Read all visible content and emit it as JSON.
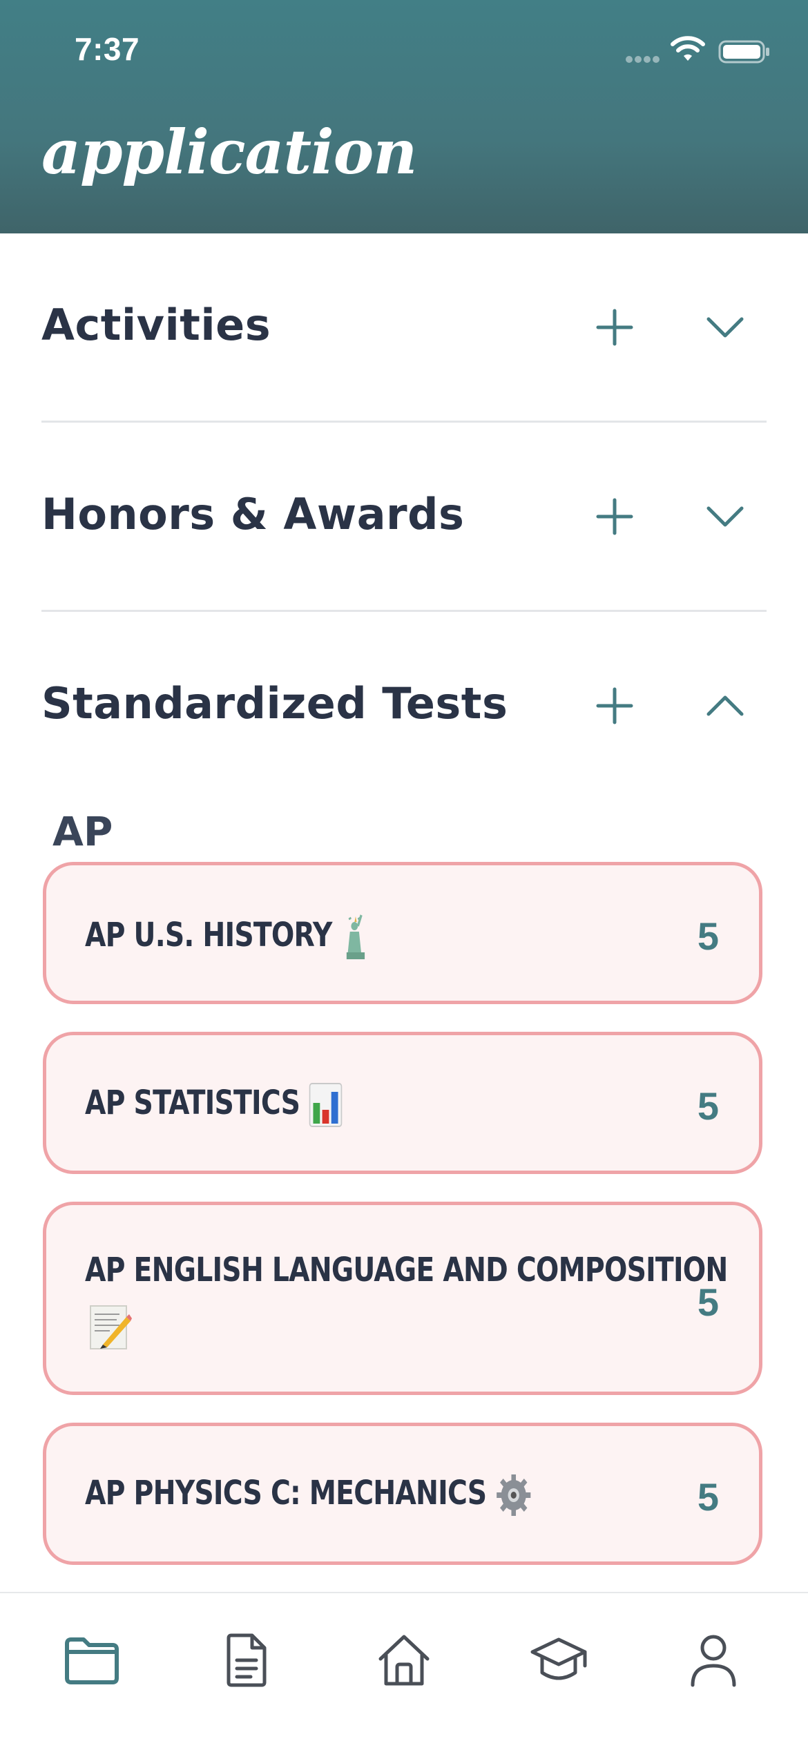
{
  "status_bar": {
    "time": "7:37"
  },
  "header": {
    "title": "application"
  },
  "sections": [
    {
      "title": "Activities",
      "expanded": false
    },
    {
      "title": "Honors & Awards",
      "expanded": false
    },
    {
      "title": "Standardized Tests",
      "expanded": true
    }
  ],
  "tests": {
    "group_label": "AP",
    "cards": [
      {
        "name": "AP U.S. HISTORY",
        "emoji": "statue-of-liberty-icon",
        "score": "5"
      },
      {
        "name": "AP STATISTICS",
        "emoji": "bar-chart-icon",
        "score": "5"
      },
      {
        "name_line1": "AP ENGLISH LANGUAGE AND COMPOSITION",
        "emoji": "memo-icon",
        "score": "5"
      },
      {
        "name": "AP PHYSICS C: MECHANICS",
        "emoji": "gear-icon",
        "score": "5"
      }
    ]
  },
  "bottom_nav": {
    "items": [
      "folder-icon",
      "document-icon",
      "home-icon",
      "graduation-cap-icon",
      "profile-icon"
    ],
    "active_index": 0
  },
  "colors": {
    "header": "#427f86",
    "accent": "#447b82",
    "card_border": "#efa3a7",
    "card_bg": "#fdf3f3",
    "text": "#2a3346"
  }
}
